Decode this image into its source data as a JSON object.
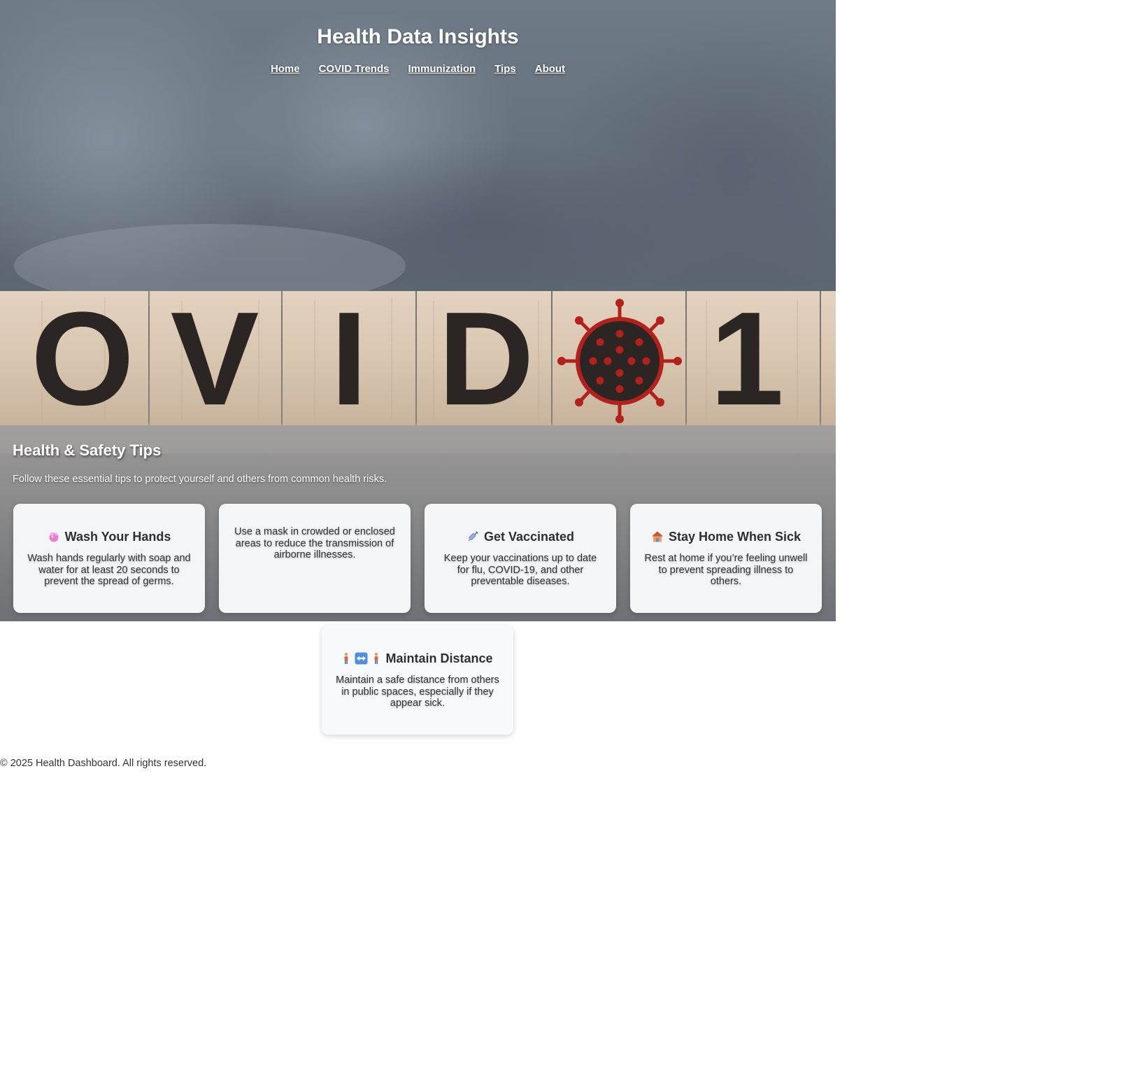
{
  "header": {
    "title": "Health Data Insights",
    "nav": [
      "Home",
      "COVID Trends",
      "Immunization",
      "Tips",
      "About"
    ]
  },
  "hero": {
    "block_letters": [
      "O",
      "V",
      "I",
      "D",
      "1"
    ]
  },
  "tips": {
    "title": "Health & Safety Tips",
    "intro": "Follow these essential tips to protect yourself and others from common health risks.",
    "cards": [
      {
        "icon": "soap-icon",
        "title": "Wash Your Hands",
        "text": "Wash hands regularly with soap and water for at least 20 seconds to prevent the spread of germs."
      },
      {
        "icon": "",
        "title": "",
        "text": "Use a mask in crowded or enclosed areas to reduce the transmission of airborne illnesses."
      },
      {
        "icon": "syringe-icon",
        "title": "Get Vaccinated",
        "text": "Keep your vaccinations up to date for flu, COVID-19, and other preventable diseases."
      },
      {
        "icon": "house-icon",
        "title": "Stay Home When Sick",
        "text": "Rest at home if you’re feeling unwell to prevent spreading illness to others."
      },
      {
        "icon": "person-arrows-person-icon",
        "title": "Maintain Distance",
        "text": "Maintain a safe distance from others in public spaces, especially if they appear sick."
      }
    ]
  },
  "footer": {
    "text": "© 2025 Health Dashboard. All rights reserved."
  },
  "colors": {
    "virus_red": "#b3211d",
    "card_bg": "#f8f9fa",
    "text_dark": "#2c2f33"
  }
}
